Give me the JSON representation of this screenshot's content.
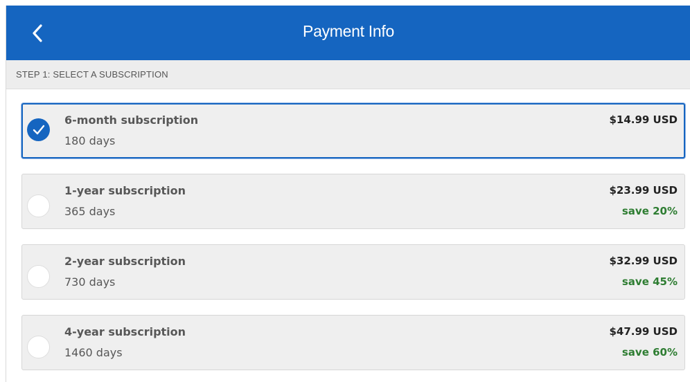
{
  "header": {
    "title": "Payment Info",
    "back_icon": "chevron-left-icon",
    "background_color": "#1565c0"
  },
  "step": {
    "label": "STEP 1: SELECT A SUBSCRIPTION"
  },
  "options": [
    {
      "name": "6-month subscription",
      "days": "180 days",
      "price": "$14.99 USD",
      "save": "",
      "selected": true
    },
    {
      "name": "1-year subscription",
      "days": "365 days",
      "price": "$23.99 USD",
      "save": "save 20%",
      "selected": false
    },
    {
      "name": "2-year subscription",
      "days": "730 days",
      "price": "$32.99 USD",
      "save": "save 45%",
      "selected": false
    },
    {
      "name": "4-year subscription",
      "days": "1460 days",
      "price": "$47.99 USD",
      "save": "save 60%",
      "selected": false
    }
  ],
  "colors": {
    "selected_border": "#1565c0",
    "save_text": "#2e7d32"
  }
}
